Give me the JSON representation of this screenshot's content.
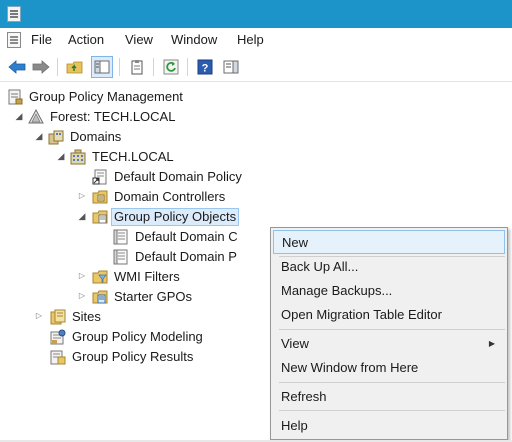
{
  "menubar": {
    "items": [
      "File",
      "Action",
      "View",
      "Window",
      "Help"
    ]
  },
  "tree": {
    "root": "Group Policy Management",
    "forest": "Forest: TECH.LOCAL",
    "domains": "Domains",
    "domain": "TECH.LOCAL",
    "default_policy": "Default Domain Policy",
    "domain_controllers": "Domain Controllers",
    "gpo_container": "Group Policy Objects",
    "gpo_child_1": "Default Domain C",
    "gpo_child_2": "Default Domain P",
    "wmi_filters": "WMI Filters",
    "starter_gpos": "Starter GPOs",
    "sites": "Sites",
    "modeling": "Group Policy Modeling",
    "results": "Group Policy Results"
  },
  "context_menu": {
    "items": [
      "New",
      "Back Up All...",
      "Manage Backups...",
      "Open Migration Table Editor",
      "View",
      "New Window from Here",
      "Refresh",
      "Help"
    ],
    "submenu_arrow": "▶"
  },
  "colors": {
    "titlebar": "#1c93c9",
    "selection": "#dcebfc",
    "menu_hover": "#e5f1fb"
  }
}
